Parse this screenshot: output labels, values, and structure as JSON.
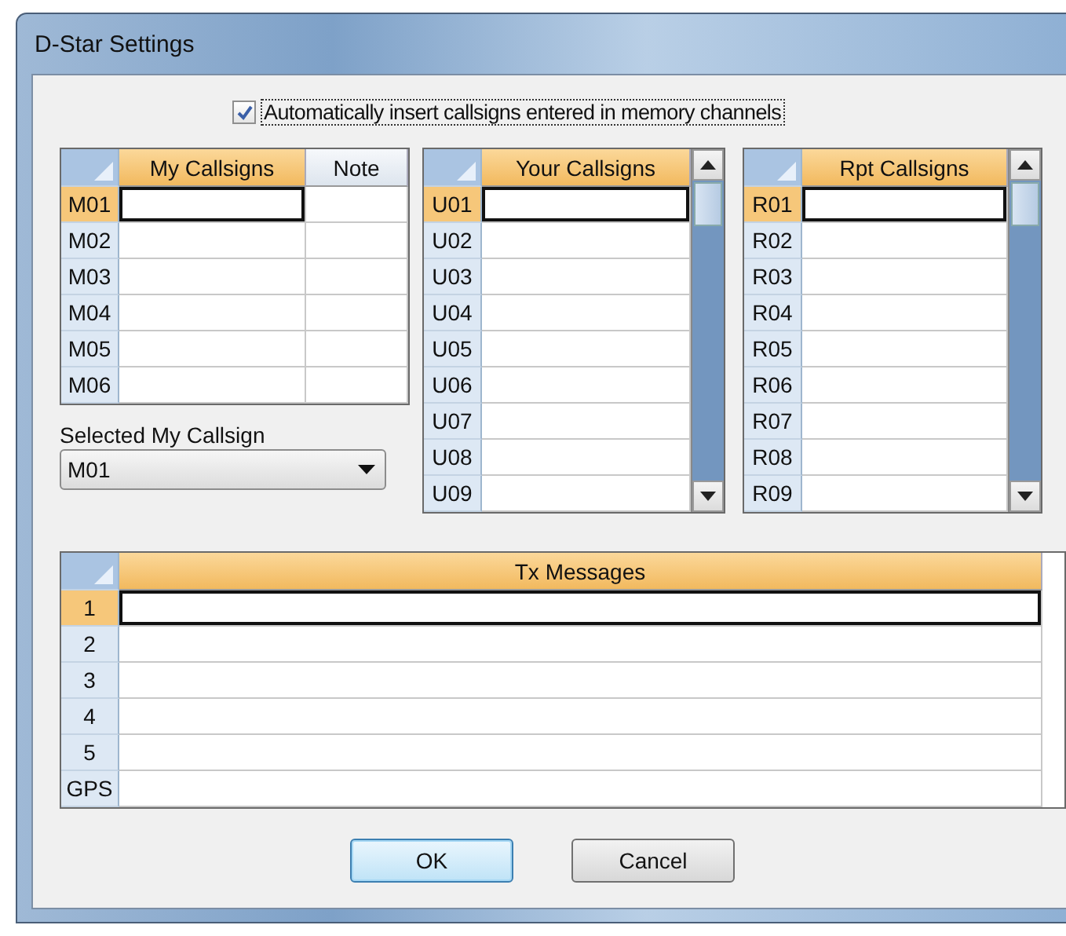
{
  "window": {
    "title": "D-Star Settings"
  },
  "auto_insert": {
    "label": "Automatically insert callsigns entered in memory channels",
    "checked": true
  },
  "my_grid": {
    "columns": [
      {
        "label": "My Callsigns",
        "selected": true
      },
      {
        "label": "Note",
        "selected": false
      }
    ],
    "rows": [
      {
        "label": "M01",
        "selected": true
      },
      {
        "label": "M02",
        "selected": false
      },
      {
        "label": "M03",
        "selected": false
      },
      {
        "label": "M04",
        "selected": false
      },
      {
        "label": "M05",
        "selected": false
      },
      {
        "label": "M06",
        "selected": false
      }
    ]
  },
  "selected_my_callsign": {
    "label": "Selected My Callsign",
    "value": "M01"
  },
  "your_grid": {
    "columns": [
      {
        "label": "Your Callsigns",
        "selected": true
      }
    ],
    "rows": [
      {
        "label": "U01",
        "selected": true
      },
      {
        "label": "U02",
        "selected": false
      },
      {
        "label": "U03",
        "selected": false
      },
      {
        "label": "U04",
        "selected": false
      },
      {
        "label": "U05",
        "selected": false
      },
      {
        "label": "U06",
        "selected": false
      },
      {
        "label": "U07",
        "selected": false
      },
      {
        "label": "U08",
        "selected": false
      },
      {
        "label": "U09",
        "selected": false
      }
    ]
  },
  "rpt_grid": {
    "columns": [
      {
        "label": "Rpt Callsigns",
        "selected": true
      }
    ],
    "rows": [
      {
        "label": "R01",
        "selected": true
      },
      {
        "label": "R02",
        "selected": false
      },
      {
        "label": "R03",
        "selected": false
      },
      {
        "label": "R04",
        "selected": false
      },
      {
        "label": "R05",
        "selected": false
      },
      {
        "label": "R06",
        "selected": false
      },
      {
        "label": "R07",
        "selected": false
      },
      {
        "label": "R08",
        "selected": false
      },
      {
        "label": "R09",
        "selected": false
      }
    ]
  },
  "tx_grid": {
    "columns": [
      {
        "label": "Tx Messages",
        "selected": true
      }
    ],
    "rows": [
      {
        "label": "1",
        "selected": true
      },
      {
        "label": "2",
        "selected": false
      },
      {
        "label": "3",
        "selected": false
      },
      {
        "label": "4",
        "selected": false
      },
      {
        "label": "5",
        "selected": false
      },
      {
        "label": "GPS",
        "selected": false
      }
    ]
  },
  "buttons": [
    {
      "label": "OK",
      "default": true
    },
    {
      "label": "Cancel",
      "default": false
    }
  ]
}
